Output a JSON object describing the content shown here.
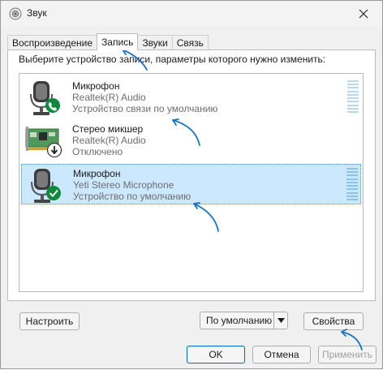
{
  "window": {
    "title": "Звук",
    "title_icon": "speaker-icon",
    "close_icon": "close-icon"
  },
  "tabs": [
    {
      "label": "Воспроизведение",
      "active": false
    },
    {
      "label": "Запись",
      "active": true
    },
    {
      "label": "Звуки",
      "active": false
    },
    {
      "label": "Связь",
      "active": false
    }
  ],
  "instruction": "Выберите устройство записи, параметры которого нужно изменить:",
  "devices": [
    {
      "name": "Микрофон",
      "driver": "Realtek(R) Audio",
      "status": "Устройство связи по умолчанию",
      "icon": "microphone-icon",
      "badge": "phone-badge-icon",
      "selected": false
    },
    {
      "name": "Стерео микшер",
      "driver": "Realtek(R) Audio",
      "status": "Отключено",
      "icon": "sound-card-icon",
      "badge": "disabled-arrow-badge-icon",
      "selected": false
    },
    {
      "name": "Микрофон",
      "driver": "Yeti Stereo Microphone",
      "status": "Устройство по умолчанию",
      "icon": "microphone-icon",
      "badge": "check-badge-icon",
      "selected": true
    }
  ],
  "buttons": {
    "configure": "Настроить",
    "set_default": "По умолчанию",
    "properties": "Свойства",
    "ok": "OK",
    "cancel": "Отмена",
    "apply": "Применить"
  },
  "colors": {
    "selection": "#cce8ff",
    "accent_arrow": "#1a73c8",
    "badge_green": "#10893e"
  }
}
